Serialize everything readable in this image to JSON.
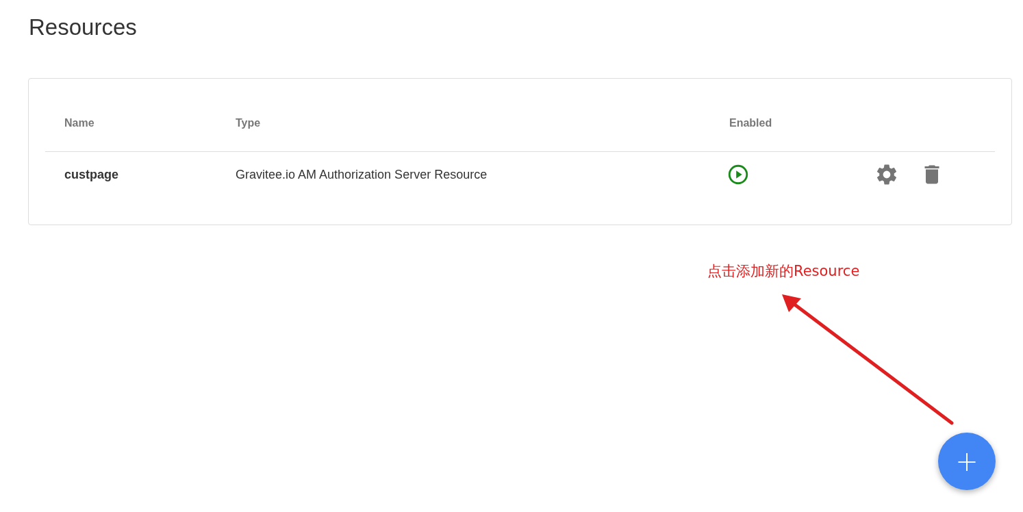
{
  "page": {
    "title": "Resources"
  },
  "table": {
    "columns": [
      "Name",
      "Type",
      "Enabled"
    ],
    "rows": [
      {
        "name": "custpage",
        "type": "Gravitee.io AM Authorization Server Resource",
        "enabled": true
      }
    ]
  },
  "annotation": {
    "text": "点击添加新的Resource"
  },
  "fab": {
    "label": "+"
  }
}
